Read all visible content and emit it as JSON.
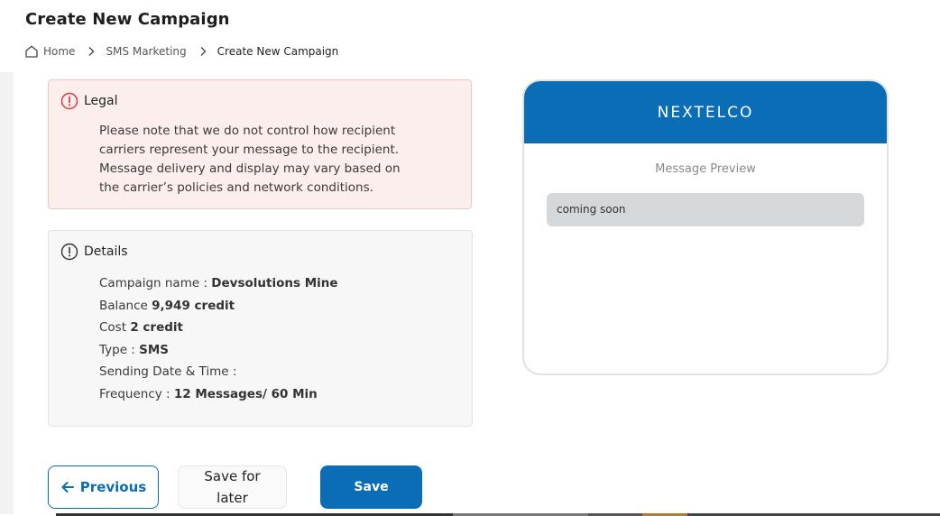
{
  "page": {
    "title": "Create New Campaign"
  },
  "breadcrumb": {
    "home": "Home",
    "section": "SMS Marketing",
    "current": "Create New Campaign"
  },
  "legal": {
    "heading": "Legal",
    "lines": [
      "Please note that we do not control how recipient",
      "carriers represent your message to the recipient.",
      "Message delivery and display may vary based on",
      "the carrier’s policies and network conditions."
    ]
  },
  "details": {
    "heading": "Details",
    "rows": [
      {
        "label": "Campaign name : ",
        "value": "Devsolutions Mine"
      },
      {
        "label": "Balance ",
        "value": "9,949 credit"
      },
      {
        "label": "Cost ",
        "value": "2 credit"
      },
      {
        "label": "Type : ",
        "value": "SMS"
      },
      {
        "label": "Sending Date & Time : ",
        "value": ""
      },
      {
        "label": "Frequency : ",
        "value": "12 Messages/ 60 Min"
      }
    ]
  },
  "preview": {
    "brand": "NEXTELCO",
    "label": "Message Preview",
    "message": "coming soon"
  },
  "buttons": {
    "previous": "Previous",
    "save_for_later_line1": "Save for",
    "save_for_later_line2": "later",
    "save": "Save"
  },
  "colors": {
    "primary": "#0a6db6",
    "legal_bg": "#fdeeee",
    "legal_border": "#f3c5c5",
    "alert_icon": "#d93a3a",
    "bubble_bg": "#d4d8db"
  },
  "icons": {
    "home": "home-icon",
    "breadcrumb_separator": "chevron-right-icon",
    "legal": "alert-circle-icon",
    "details": "info-circle-icon",
    "previous": "arrow-left-icon"
  }
}
